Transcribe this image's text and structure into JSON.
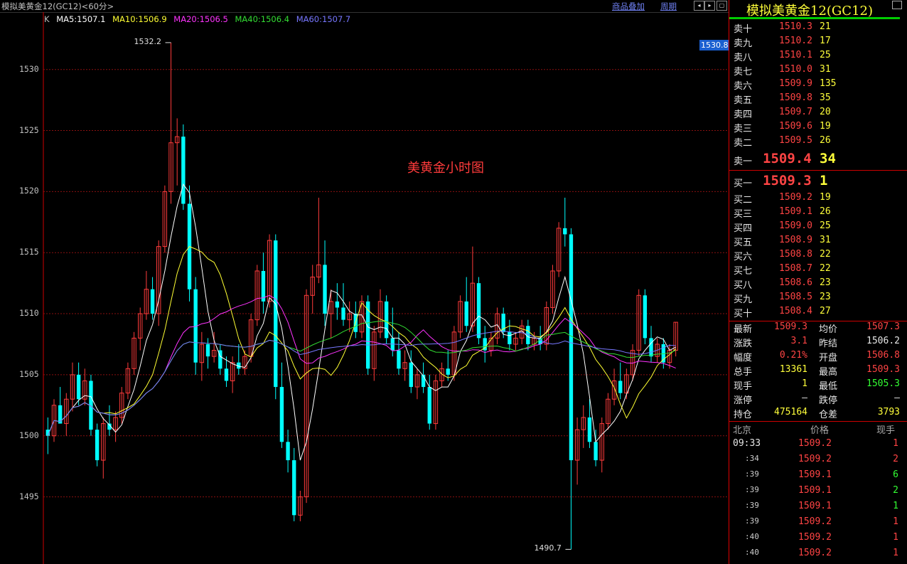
{
  "window": {
    "title": "模拟美黄金12(GC12)<60分>",
    "links": [
      "商品叠加",
      "周期"
    ],
    "buttons": [
      "◂",
      "▸",
      "▢"
    ]
  },
  "chart": {
    "legend": {
      "k": "K",
      "ma5": "MA5:1507.1",
      "ma10": "MA10:1506.9",
      "ma20": "MA20:1506.5",
      "ma40": "MA40:1506.4",
      "ma60": "MA60:1507.7"
    },
    "legend_colors": {
      "k": "#c0c0c0",
      "ma5": "#ffffff",
      "ma10": "#ffff33",
      "ma20": "#ff33ff",
      "ma40": "#33dd33",
      "ma60": "#7777ff"
    },
    "note": "美黄金小时图",
    "current_tag": "1530.8",
    "high_label": "1532.2",
    "low_label": "1490.7"
  },
  "chart_data": {
    "type": "candlestick",
    "ylim": [
      1489.5,
      1534.7
    ],
    "yticks": [
      1495,
      1500,
      1505,
      1510,
      1515,
      1520,
      1525,
      1530
    ],
    "grid": true,
    "max": 1532.2,
    "min": 1490.7,
    "ma_periods": [
      5,
      10,
      20,
      40,
      60
    ],
    "ohlc": [
      [
        1500.5,
        1501.5,
        1498.5,
        1500.0
      ],
      [
        1500.0,
        1503.0,
        1499.5,
        1502.5
      ],
      [
        1502.5,
        1504.0,
        1501.5,
        1501.0
      ],
      [
        1501.0,
        1503.5,
        1500.0,
        1503.0
      ],
      [
        1503.0,
        1506.0,
        1502.0,
        1505.0
      ],
      [
        1505.0,
        1506.0,
        1502.5,
        1503.0
      ],
      [
        1503.0,
        1505.5,
        1502.5,
        1504.5
      ],
      [
        1504.5,
        1505.0,
        1500.0,
        1500.5
      ],
      [
        1500.5,
        1501.0,
        1497.5,
        1498.0
      ],
      [
        1498.0,
        1501.5,
        1496.5,
        1501.0
      ],
      [
        1501.0,
        1502.5,
        1500.0,
        1500.5
      ],
      [
        1500.5,
        1502.0,
        1499.5,
        1501.5
      ],
      [
        1501.5,
        1504.0,
        1501.0,
        1503.5
      ],
      [
        1503.5,
        1506.0,
        1503.0,
        1505.5
      ],
      [
        1505.5,
        1508.5,
        1505.0,
        1508.0
      ],
      [
        1508.0,
        1510.5,
        1507.0,
        1510.0
      ],
      [
        1510.0,
        1513.5,
        1509.5,
        1512.0
      ],
      [
        1512.0,
        1513.0,
        1509.5,
        1510.0
      ],
      [
        1510.0,
        1516.0,
        1509.0,
        1515.5
      ],
      [
        1515.5,
        1520.5,
        1515.0,
        1520.0
      ],
      [
        1520.0,
        1532.2,
        1519.0,
        1524.0
      ],
      [
        1524.0,
        1526.0,
        1520.5,
        1524.5
      ],
      [
        1524.5,
        1525.5,
        1518.5,
        1519.0
      ],
      [
        1519.0,
        1520.5,
        1511.0,
        1512.0
      ],
      [
        1512.0,
        1513.0,
        1505.0,
        1506.0
      ],
      [
        1506.0,
        1508.5,
        1504.5,
        1507.5
      ],
      [
        1507.5,
        1508.0,
        1505.5,
        1506.5
      ],
      [
        1506.5,
        1508.5,
        1506.0,
        1507.0
      ],
      [
        1507.0,
        1507.5,
        1505.0,
        1505.5
      ],
      [
        1505.5,
        1506.5,
        1504.0,
        1504.5
      ],
      [
        1504.5,
        1506.5,
        1503.5,
        1506.0
      ],
      [
        1506.0,
        1507.5,
        1505.0,
        1505.5
      ],
      [
        1505.5,
        1507.0,
        1505.0,
        1506.5
      ],
      [
        1506.5,
        1510.0,
        1506.0,
        1509.5
      ],
      [
        1509.5,
        1514.0,
        1509.0,
        1513.5
      ],
      [
        1513.5,
        1515.0,
        1510.0,
        1511.0
      ],
      [
        1511.0,
        1516.5,
        1510.5,
        1516.0
      ],
      [
        1516.0,
        1516.5,
        1503.0,
        1504.0
      ],
      [
        1504.0,
        1506.0,
        1499.0,
        1499.5
      ],
      [
        1499.5,
        1500.5,
        1497.0,
        1498.0
      ],
      [
        1498.0,
        1499.0,
        1493.0,
        1493.5
      ],
      [
        1493.5,
        1495.5,
        1493.0,
        1495.0
      ],
      [
        1495.0,
        1512.0,
        1494.5,
        1511.5
      ],
      [
        1511.5,
        1514.0,
        1510.0,
        1513.0
      ],
      [
        1513.0,
        1519.5,
        1512.5,
        1514.0
      ],
      [
        1514.0,
        1516.0,
        1509.0,
        1510.0
      ],
      [
        1510.0,
        1512.0,
        1508.0,
        1511.0
      ],
      [
        1511.0,
        1512.5,
        1509.5,
        1510.5
      ],
      [
        1510.5,
        1512.5,
        1509.0,
        1509.5
      ],
      [
        1509.5,
        1511.0,
        1508.5,
        1510.0
      ],
      [
        1510.0,
        1511.0,
        1508.0,
        1508.5
      ],
      [
        1508.5,
        1511.5,
        1508.0,
        1511.0
      ],
      [
        1511.0,
        1511.5,
        1505.0,
        1505.5
      ],
      [
        1505.5,
        1509.0,
        1504.5,
        1508.5
      ],
      [
        1508.5,
        1512.0,
        1508.0,
        1511.0
      ],
      [
        1511.0,
        1511.5,
        1507.5,
        1508.0
      ],
      [
        1508.0,
        1510.5,
        1506.5,
        1507.0
      ],
      [
        1507.0,
        1508.5,
        1505.0,
        1505.5
      ],
      [
        1505.5,
        1507.0,
        1504.5,
        1506.0
      ],
      [
        1506.0,
        1507.0,
        1503.5,
        1504.0
      ],
      [
        1504.0,
        1505.5,
        1503.0,
        1505.0
      ],
      [
        1505.0,
        1506.0,
        1503.5,
        1504.0
      ],
      [
        1504.0,
        1505.0,
        1500.5,
        1501.0
      ],
      [
        1501.0,
        1505.0,
        1500.5,
        1504.5
      ],
      [
        1504.5,
        1506.0,
        1504.0,
        1505.5
      ],
      [
        1505.5,
        1507.0,
        1504.5,
        1505.0
      ],
      [
        1505.0,
        1509.0,
        1504.5,
        1508.5
      ],
      [
        1508.5,
        1511.5,
        1508.0,
        1511.0
      ],
      [
        1511.0,
        1513.0,
        1508.5,
        1509.0
      ],
      [
        1509.0,
        1515.5,
        1508.5,
        1512.5
      ],
      [
        1512.5,
        1513.0,
        1507.5,
        1508.0
      ],
      [
        1508.0,
        1509.0,
        1506.0,
        1507.0
      ],
      [
        1507.0,
        1508.5,
        1506.5,
        1508.0
      ],
      [
        1508.0,
        1510.5,
        1507.5,
        1510.0
      ],
      [
        1510.0,
        1510.5,
        1508.0,
        1508.5
      ],
      [
        1508.5,
        1509.5,
        1507.0,
        1507.5
      ],
      [
        1507.5,
        1508.5,
        1507.0,
        1508.0
      ],
      [
        1508.0,
        1509.5,
        1507.5,
        1509.0
      ],
      [
        1509.0,
        1509.5,
        1507.0,
        1507.5
      ],
      [
        1507.5,
        1508.5,
        1507.0,
        1508.0
      ],
      [
        1508.0,
        1509.0,
        1507.0,
        1507.5
      ],
      [
        1507.5,
        1511.0,
        1507.0,
        1510.5
      ],
      [
        1510.5,
        1514.0,
        1510.0,
        1513.5
      ],
      [
        1513.5,
        1517.5,
        1513.0,
        1517.0
      ],
      [
        1517.0,
        1519.5,
        1515.5,
        1516.5
      ],
      [
        1516.5,
        1517.0,
        1490.7,
        1498.0
      ],
      [
        1498.0,
        1501.5,
        1496.0,
        1500.5
      ],
      [
        1500.5,
        1502.5,
        1499.0,
        1501.5
      ],
      [
        1501.5,
        1503.0,
        1499.0,
        1499.5
      ],
      [
        1499.5,
        1500.5,
        1497.5,
        1498.0
      ],
      [
        1498.0,
        1501.5,
        1497.0,
        1501.0
      ],
      [
        1501.0,
        1503.5,
        1500.5,
        1503.0
      ],
      [
        1503.0,
        1505.5,
        1502.5,
        1504.5
      ],
      [
        1504.5,
        1506.0,
        1503.0,
        1503.5
      ],
      [
        1503.5,
        1505.5,
        1503.0,
        1505.0
      ],
      [
        1505.0,
        1507.5,
        1504.5,
        1507.0
      ],
      [
        1507.0,
        1512.0,
        1506.5,
        1511.5
      ],
      [
        1511.5,
        1512.0,
        1507.5,
        1508.0
      ],
      [
        1508.0,
        1509.0,
        1506.0,
        1506.5
      ],
      [
        1506.5,
        1508.0,
        1506.0,
        1507.5
      ],
      [
        1507.5,
        1508.0,
        1505.5,
        1506.0
      ],
      [
        1506.0,
        1507.5,
        1505.5,
        1507.0
      ],
      [
        1507.0,
        1509.3,
        1506.5,
        1509.3
      ]
    ]
  },
  "panel": {
    "title": "模拟美黄金12(GC12)",
    "asks": [
      {
        "label": "卖十",
        "price": "1510.3",
        "vol": "21"
      },
      {
        "label": "卖九",
        "price": "1510.2",
        "vol": "17"
      },
      {
        "label": "卖八",
        "price": "1510.1",
        "vol": "25"
      },
      {
        "label": "卖七",
        "price": "1510.0",
        "vol": "31"
      },
      {
        "label": "卖六",
        "price": "1509.9",
        "vol": "135"
      },
      {
        "label": "卖五",
        "price": "1509.8",
        "vol": "35"
      },
      {
        "label": "卖四",
        "price": "1509.7",
        "vol": "20"
      },
      {
        "label": "卖三",
        "price": "1509.6",
        "vol": "19"
      },
      {
        "label": "卖二",
        "price": "1509.5",
        "vol": "26"
      },
      {
        "label": "卖一",
        "price": "1509.4",
        "vol": "34"
      }
    ],
    "bids": [
      {
        "label": "买一",
        "price": "1509.3",
        "vol": "1"
      },
      {
        "label": "买二",
        "price": "1509.2",
        "vol": "19"
      },
      {
        "label": "买三",
        "price": "1509.1",
        "vol": "26"
      },
      {
        "label": "买四",
        "price": "1509.0",
        "vol": "25"
      },
      {
        "label": "买五",
        "price": "1508.9",
        "vol": "31"
      },
      {
        "label": "买六",
        "price": "1508.8",
        "vol": "22"
      },
      {
        "label": "买七",
        "price": "1508.7",
        "vol": "22"
      },
      {
        "label": "买八",
        "price": "1508.6",
        "vol": "23"
      },
      {
        "label": "买九",
        "price": "1508.5",
        "vol": "23"
      },
      {
        "label": "买十",
        "price": "1508.4",
        "vol": "27"
      }
    ],
    "quote": [
      {
        "l": "最新",
        "v": "1509.3",
        "vc": "#ff4444",
        "r": "均价",
        "rv": "1507.3",
        "rc": "#ff4444"
      },
      {
        "l": "涨跌",
        "v": "3.1",
        "vc": "#ff4444",
        "r": "昨结",
        "rv": "1506.2",
        "rc": "#e6e6e6"
      },
      {
        "l": "幅度",
        "v": "0.21%",
        "vc": "#ff4444",
        "r": "开盘",
        "rv": "1506.8",
        "rc": "#ff4444"
      },
      {
        "l": "总手",
        "v": "13361",
        "vc": "#ffff3a",
        "r": "最高",
        "rv": "1509.3",
        "rc": "#ff4444"
      },
      {
        "l": "现手",
        "v": "1",
        "vc": "#ffff3a",
        "r": "最低",
        "rv": "1505.3",
        "rc": "#33ff33"
      },
      {
        "l": "涨停",
        "v": "—",
        "vc": "#e6e6e6",
        "r": "跌停",
        "rv": "—",
        "rc": "#e6e6e6"
      },
      {
        "l": "持仓",
        "v": "475164",
        "vc": "#ffff3a",
        "r": "仓差",
        "rv": "3793",
        "rc": "#ffff3a"
      }
    ],
    "ticks_header": {
      "time": "北京",
      "price": "价格",
      "vol": "现手"
    },
    "ticks": [
      {
        "time": "09:33",
        "price": "1509.2",
        "vol": "1"
      },
      {
        "time": ":34",
        "price": "1509.2",
        "vol": "2"
      },
      {
        "time": ":39",
        "price": "1509.1",
        "vol": "6"
      },
      {
        "time": ":39",
        "price": "1509.1",
        "vol": "2"
      },
      {
        "time": ":39",
        "price": "1509.1",
        "vol": "1"
      },
      {
        "time": ":39",
        "price": "1509.2",
        "vol": "1"
      },
      {
        "time": ":40",
        "price": "1509.2",
        "vol": "1"
      },
      {
        "time": ":40",
        "price": "1509.2",
        "vol": "1"
      }
    ],
    "tick_vol_colors": [
      "#ff4444",
      "#ff4444",
      "#33ff33",
      "#33ff33",
      "#33ff33",
      "#ff4444",
      "#ff4444",
      "#ff4444"
    ]
  }
}
